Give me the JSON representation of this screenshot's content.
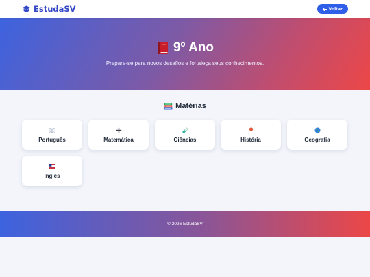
{
  "navbar": {
    "brand": "EstudaSV",
    "back_label": "Voltar",
    "brand_color": "#3347c6",
    "button_color": "#2f5ee8"
  },
  "hero": {
    "title": "9º Ano",
    "subtitle": "Prepare-se para novos desafios e fortaleça seus conhecimentos.",
    "icon": "red-book-icon",
    "gradient": [
      "#3d63df",
      "#ec4747"
    ]
  },
  "section": {
    "title": "Matérias",
    "icon": "books-icon"
  },
  "subjects": [
    {
      "label": "Português",
      "icon": "open-book-icon"
    },
    {
      "label": "Matemática",
      "icon": "plus-minus-icon"
    },
    {
      "label": "Ciências",
      "icon": "test-tube-icon"
    },
    {
      "label": "História",
      "icon": "pushpin-icon"
    },
    {
      "label": "Geografia",
      "icon": "globe-icon"
    },
    {
      "label": "Inglês",
      "icon": "us-flag-icon"
    }
  ],
  "footer": {
    "text": "© 2026 EstudaSV"
  }
}
